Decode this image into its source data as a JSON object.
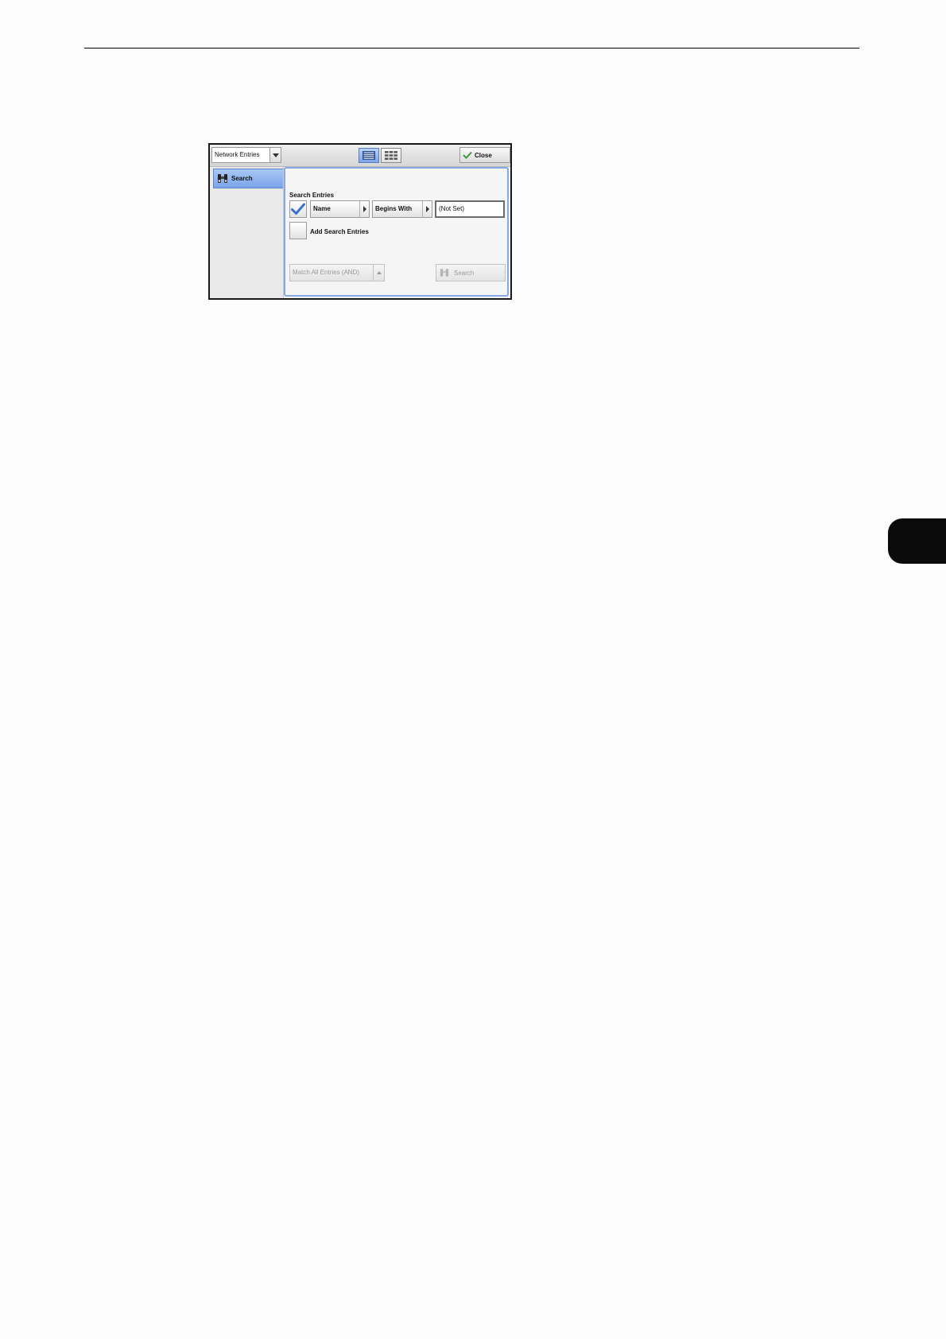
{
  "topbar": {
    "address_book": {
      "selected": "Network Entries",
      "icon": "chevron-down-icon"
    },
    "view_toggle": {
      "list_view_icon": "list-view-icon",
      "grid_view_icon": "grid-view-icon",
      "active": "list"
    },
    "close": {
      "label": "Close",
      "icon": "check-icon"
    }
  },
  "sidebar": {
    "items": [
      {
        "label": "Search",
        "icon": "binoculars-icon",
        "selected": true
      }
    ]
  },
  "search_panel": {
    "title": "Search Entries",
    "entry": {
      "enabled": true,
      "field": "Name",
      "condition": "Begins With",
      "value": "(Not Set)"
    },
    "add_entries_label": "Add Search Entries",
    "match_mode": "Match All Entries (AND)",
    "search_label": "Search"
  },
  "colors": {
    "accent": "#7ba4ea",
    "panel_border": "#88a9e3",
    "disabled_text": "#9a9a9a",
    "side_tab": "#0b0b0b"
  }
}
